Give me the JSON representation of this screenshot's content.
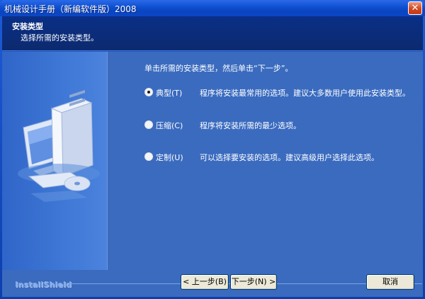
{
  "window": {
    "title": "机械设计手册（新编软件版）2008",
    "close_label": "✕"
  },
  "header": {
    "title": "安装类型",
    "subtitle": "选择所需的安装类型。"
  },
  "main": {
    "instruction": "单击所需的安装类型，然后单击“下一步”。",
    "options": [
      {
        "label": "典型(T)",
        "description": "程序将安装最常用的选项。建议大多数用户使用此安装类型。",
        "selected": true
      },
      {
        "label": "压缩(C)",
        "description": "程序将安装所需的最少选项。",
        "selected": false
      },
      {
        "label": "定制(U)",
        "description": "可以选择要安装的选项。建议高级用户选择此选项。",
        "selected": false
      }
    ]
  },
  "footer": {
    "brand": "InstallShield",
    "back_label": "< 上一步(B)",
    "next_label": "下一步(N) >",
    "cancel_label": "取消"
  }
}
